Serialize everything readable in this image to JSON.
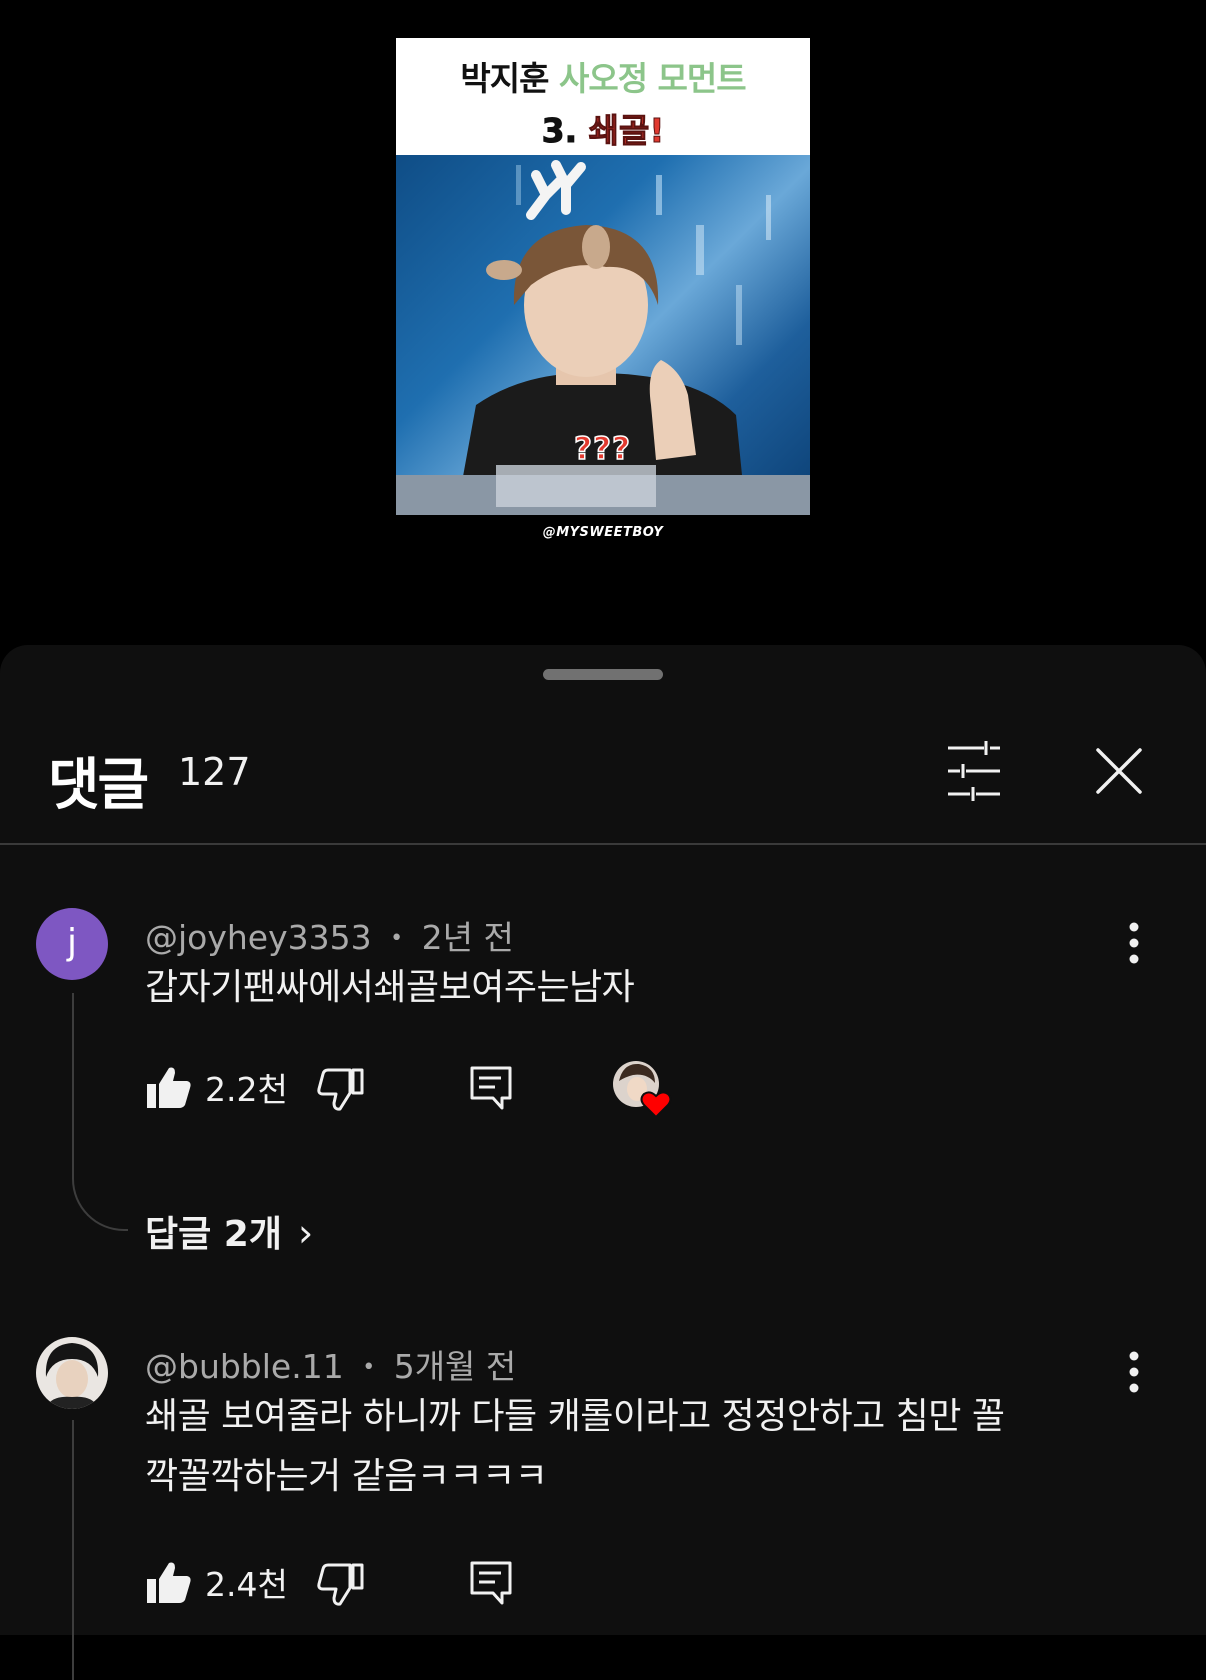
{
  "video": {
    "title_black": "박지훈",
    "title_green": "사오정 모먼트",
    "subtitle_number": "3.",
    "subtitle_red": "쇄골!",
    "caption": "???",
    "watermark": "@MYSWEETBOY",
    "colors": {
      "green": "#8cc58a",
      "red": "#e0392f"
    }
  },
  "comments_panel": {
    "title": "댓글",
    "count": "127",
    "icons": {
      "filter": "sliders-icon",
      "close": "close-icon"
    }
  },
  "comments": [
    {
      "avatar_letter": "j",
      "avatar_color": "#7e57c2",
      "author": "@joyhey3353",
      "separator": "•",
      "time": "2년 전",
      "text": "갑자기팬싸에서쇄골보여주는남자",
      "likes": "2.2천",
      "creator_heart": true,
      "replies_label": "답글 2개",
      "replies_chevron": "›"
    },
    {
      "author": "@bubble.11",
      "separator": "•",
      "time": "5개월 전",
      "text_line1": "쇄골 보여줄라 하니까 다들 캐롤이라고 정정안하고 침만 꼴",
      "text_line2": "깍꼴깍하는거 같음ㅋㅋㅋㅋ",
      "likes": "2.4천"
    }
  ]
}
